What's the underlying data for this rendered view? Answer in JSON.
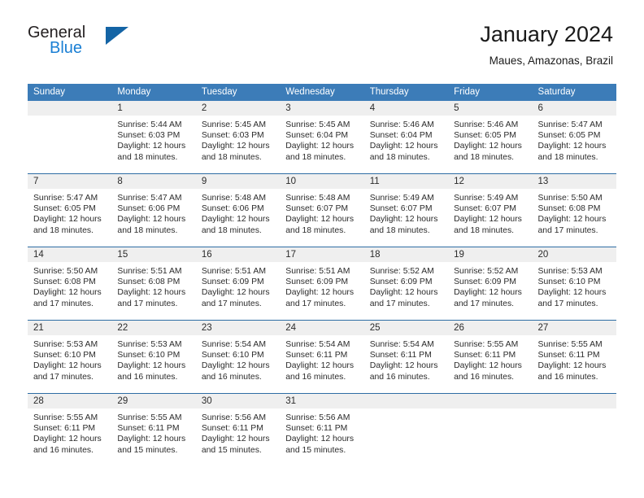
{
  "brand": {
    "name_part1": "General",
    "name_part2": "Blue",
    "logo_icon": "triangle-logo-icon"
  },
  "header": {
    "title": "January 2024",
    "subtitle": "Maues, Amazonas, Brazil"
  },
  "calendar": {
    "weekday_headers": [
      "Sunday",
      "Monday",
      "Tuesday",
      "Wednesday",
      "Thursday",
      "Friday",
      "Saturday"
    ],
    "accent_color": "#3c7cb8",
    "separator_color": "#2e6da4",
    "day_band_color": "#efefef",
    "weeks": [
      [
        {
          "day": "",
          "empty": true
        },
        {
          "day": "1",
          "sunrise": "Sunrise: 5:44 AM",
          "sunset": "Sunset: 6:03 PM",
          "daylight1": "Daylight: 12 hours",
          "daylight2": "and 18 minutes."
        },
        {
          "day": "2",
          "sunrise": "Sunrise: 5:45 AM",
          "sunset": "Sunset: 6:03 PM",
          "daylight1": "Daylight: 12 hours",
          "daylight2": "and 18 minutes."
        },
        {
          "day": "3",
          "sunrise": "Sunrise: 5:45 AM",
          "sunset": "Sunset: 6:04 PM",
          "daylight1": "Daylight: 12 hours",
          "daylight2": "and 18 minutes."
        },
        {
          "day": "4",
          "sunrise": "Sunrise: 5:46 AM",
          "sunset": "Sunset: 6:04 PM",
          "daylight1": "Daylight: 12 hours",
          "daylight2": "and 18 minutes."
        },
        {
          "day": "5",
          "sunrise": "Sunrise: 5:46 AM",
          "sunset": "Sunset: 6:05 PM",
          "daylight1": "Daylight: 12 hours",
          "daylight2": "and 18 minutes."
        },
        {
          "day": "6",
          "sunrise": "Sunrise: 5:47 AM",
          "sunset": "Sunset: 6:05 PM",
          "daylight1": "Daylight: 12 hours",
          "daylight2": "and 18 minutes."
        }
      ],
      [
        {
          "day": "7",
          "sunrise": "Sunrise: 5:47 AM",
          "sunset": "Sunset: 6:05 PM",
          "daylight1": "Daylight: 12 hours",
          "daylight2": "and 18 minutes."
        },
        {
          "day": "8",
          "sunrise": "Sunrise: 5:47 AM",
          "sunset": "Sunset: 6:06 PM",
          "daylight1": "Daylight: 12 hours",
          "daylight2": "and 18 minutes."
        },
        {
          "day": "9",
          "sunrise": "Sunrise: 5:48 AM",
          "sunset": "Sunset: 6:06 PM",
          "daylight1": "Daylight: 12 hours",
          "daylight2": "and 18 minutes."
        },
        {
          "day": "10",
          "sunrise": "Sunrise: 5:48 AM",
          "sunset": "Sunset: 6:07 PM",
          "daylight1": "Daylight: 12 hours",
          "daylight2": "and 18 minutes."
        },
        {
          "day": "11",
          "sunrise": "Sunrise: 5:49 AM",
          "sunset": "Sunset: 6:07 PM",
          "daylight1": "Daylight: 12 hours",
          "daylight2": "and 18 minutes."
        },
        {
          "day": "12",
          "sunrise": "Sunrise: 5:49 AM",
          "sunset": "Sunset: 6:07 PM",
          "daylight1": "Daylight: 12 hours",
          "daylight2": "and 18 minutes."
        },
        {
          "day": "13",
          "sunrise": "Sunrise: 5:50 AM",
          "sunset": "Sunset: 6:08 PM",
          "daylight1": "Daylight: 12 hours",
          "daylight2": "and 17 minutes."
        }
      ],
      [
        {
          "day": "14",
          "sunrise": "Sunrise: 5:50 AM",
          "sunset": "Sunset: 6:08 PM",
          "daylight1": "Daylight: 12 hours",
          "daylight2": "and 17 minutes."
        },
        {
          "day": "15",
          "sunrise": "Sunrise: 5:51 AM",
          "sunset": "Sunset: 6:08 PM",
          "daylight1": "Daylight: 12 hours",
          "daylight2": "and 17 minutes."
        },
        {
          "day": "16",
          "sunrise": "Sunrise: 5:51 AM",
          "sunset": "Sunset: 6:09 PM",
          "daylight1": "Daylight: 12 hours",
          "daylight2": "and 17 minutes."
        },
        {
          "day": "17",
          "sunrise": "Sunrise: 5:51 AM",
          "sunset": "Sunset: 6:09 PM",
          "daylight1": "Daylight: 12 hours",
          "daylight2": "and 17 minutes."
        },
        {
          "day": "18",
          "sunrise": "Sunrise: 5:52 AM",
          "sunset": "Sunset: 6:09 PM",
          "daylight1": "Daylight: 12 hours",
          "daylight2": "and 17 minutes."
        },
        {
          "day": "19",
          "sunrise": "Sunrise: 5:52 AM",
          "sunset": "Sunset: 6:09 PM",
          "daylight1": "Daylight: 12 hours",
          "daylight2": "and 17 minutes."
        },
        {
          "day": "20",
          "sunrise": "Sunrise: 5:53 AM",
          "sunset": "Sunset: 6:10 PM",
          "daylight1": "Daylight: 12 hours",
          "daylight2": "and 17 minutes."
        }
      ],
      [
        {
          "day": "21",
          "sunrise": "Sunrise: 5:53 AM",
          "sunset": "Sunset: 6:10 PM",
          "daylight1": "Daylight: 12 hours",
          "daylight2": "and 17 minutes."
        },
        {
          "day": "22",
          "sunrise": "Sunrise: 5:53 AM",
          "sunset": "Sunset: 6:10 PM",
          "daylight1": "Daylight: 12 hours",
          "daylight2": "and 16 minutes."
        },
        {
          "day": "23",
          "sunrise": "Sunrise: 5:54 AM",
          "sunset": "Sunset: 6:10 PM",
          "daylight1": "Daylight: 12 hours",
          "daylight2": "and 16 minutes."
        },
        {
          "day": "24",
          "sunrise": "Sunrise: 5:54 AM",
          "sunset": "Sunset: 6:11 PM",
          "daylight1": "Daylight: 12 hours",
          "daylight2": "and 16 minutes."
        },
        {
          "day": "25",
          "sunrise": "Sunrise: 5:54 AM",
          "sunset": "Sunset: 6:11 PM",
          "daylight1": "Daylight: 12 hours",
          "daylight2": "and 16 minutes."
        },
        {
          "day": "26",
          "sunrise": "Sunrise: 5:55 AM",
          "sunset": "Sunset: 6:11 PM",
          "daylight1": "Daylight: 12 hours",
          "daylight2": "and 16 minutes."
        },
        {
          "day": "27",
          "sunrise": "Sunrise: 5:55 AM",
          "sunset": "Sunset: 6:11 PM",
          "daylight1": "Daylight: 12 hours",
          "daylight2": "and 16 minutes."
        }
      ],
      [
        {
          "day": "28",
          "sunrise": "Sunrise: 5:55 AM",
          "sunset": "Sunset: 6:11 PM",
          "daylight1": "Daylight: 12 hours",
          "daylight2": "and 16 minutes."
        },
        {
          "day": "29",
          "sunrise": "Sunrise: 5:55 AM",
          "sunset": "Sunset: 6:11 PM",
          "daylight1": "Daylight: 12 hours",
          "daylight2": "and 15 minutes."
        },
        {
          "day": "30",
          "sunrise": "Sunrise: 5:56 AM",
          "sunset": "Sunset: 6:11 PM",
          "daylight1": "Daylight: 12 hours",
          "daylight2": "and 15 minutes."
        },
        {
          "day": "31",
          "sunrise": "Sunrise: 5:56 AM",
          "sunset": "Sunset: 6:11 PM",
          "daylight1": "Daylight: 12 hours",
          "daylight2": "and 15 minutes."
        },
        {
          "day": "",
          "empty": true
        },
        {
          "day": "",
          "empty": true
        },
        {
          "day": "",
          "empty": true
        }
      ]
    ]
  }
}
